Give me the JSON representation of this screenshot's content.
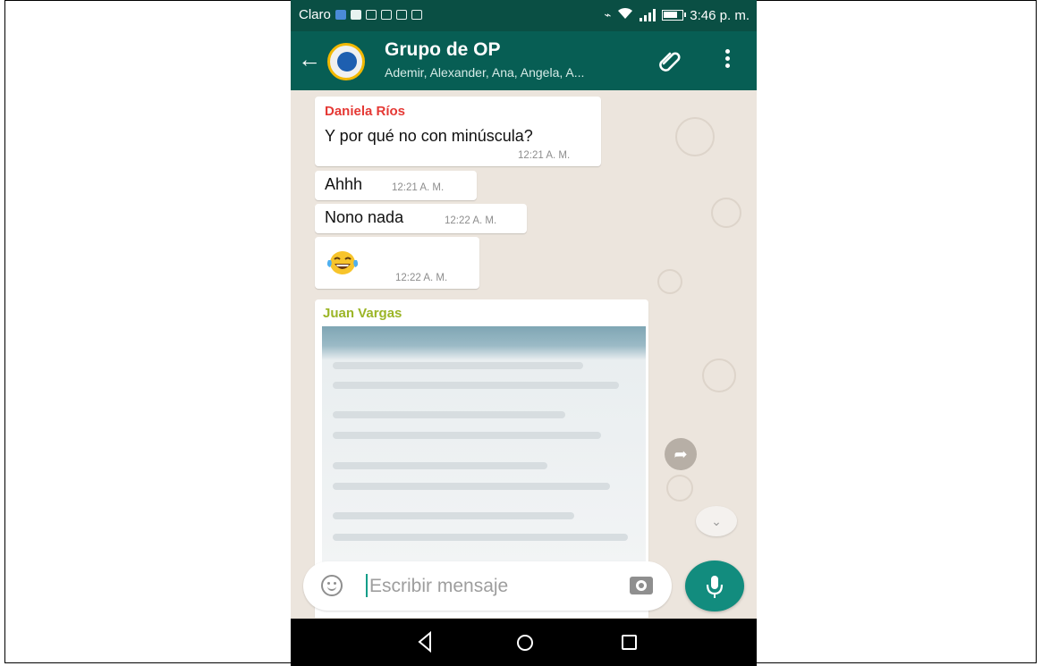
{
  "status_bar": {
    "carrier": "Claro",
    "time": "3:46 p. m."
  },
  "header": {
    "back_icon": "arrow-left-icon",
    "title": "Grupo de OP",
    "subtitle": "Ademir, Alexander, Ana, Angela, A...",
    "attach_icon": "paperclip-icon",
    "menu_icon": "more-vert-icon",
    "color": "#075e54"
  },
  "messages": [
    {
      "sender": "Daniela Ríos",
      "sender_color": "#e53935",
      "text": "Y por qué no con minúscula?",
      "time": "12:21 A. M."
    },
    {
      "text": "Ahhh",
      "time": "12:21 A. M."
    },
    {
      "text": "Nono nada",
      "time": "12:22 A. M."
    },
    {
      "emoji": "face-with-tears-of-joy",
      "time": "12:22 A. M."
    },
    {
      "sender": "Juan Vargas",
      "sender_color": "#9bb526",
      "image": "blurred-screenshot"
    }
  ],
  "input": {
    "placeholder": "Escribir mensaje",
    "emoji_icon": "smiley-icon",
    "camera_icon": "camera-icon",
    "mic_icon": "microphone-icon"
  },
  "accent": "#128c7e",
  "nav": [
    "back-triangle-icon",
    "home-circle-icon",
    "recents-square-icon"
  ]
}
